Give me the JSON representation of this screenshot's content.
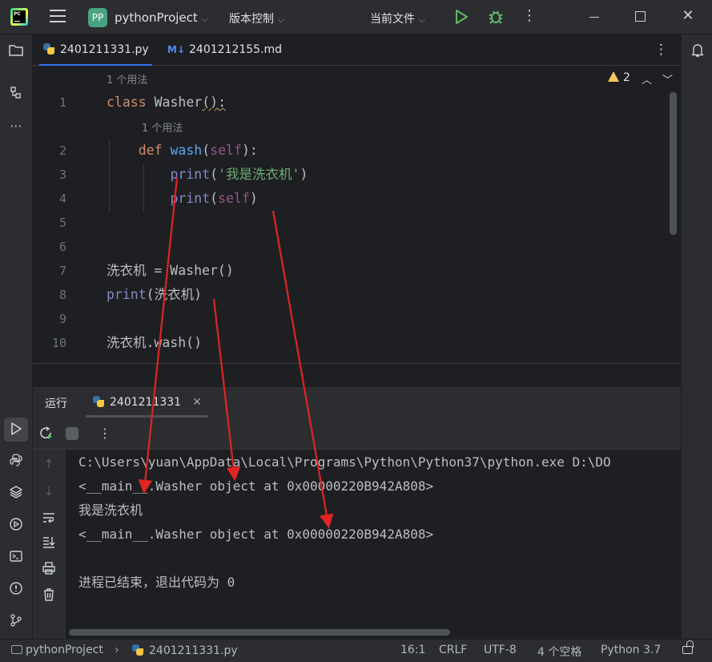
{
  "titlebar": {
    "logo_text": "PC",
    "project_badge": "PP",
    "project_name": "pythonProject",
    "vcs_label": "版本控制",
    "run_config": "当前文件",
    "icons": [
      "hamburger-menu-icon",
      "run-icon",
      "debug-icon",
      "more-icon",
      "minimize-icon",
      "maximize-icon",
      "close-icon"
    ]
  },
  "tabs": [
    {
      "label": "2401211331.py",
      "icon": "python-file-icon",
      "active": true
    },
    {
      "label": "2401212155.md",
      "icon": "markdown-file-icon",
      "active": false
    }
  ],
  "editor": {
    "usage_hint_class": "1 个用法",
    "usage_hint_method": "1 个用法",
    "warning_count": "2",
    "lines": [
      {
        "num": "1"
      },
      {
        "num": "2"
      },
      {
        "num": "3"
      },
      {
        "num": "4"
      },
      {
        "num": "5"
      },
      {
        "num": "6"
      },
      {
        "num": "7"
      },
      {
        "num": "8"
      },
      {
        "num": "9"
      },
      {
        "num": "10"
      }
    ],
    "code": {
      "l1_kw": "class",
      "l1_name": "Washer",
      "l1_rest": "():",
      "l2_kw": "def",
      "l2_fn": "wash",
      "l2_self": "self",
      "l3_fn": "print",
      "l3_str": "'我是洗衣机'",
      "l4_fn": "print",
      "l4_self": "self",
      "l7_text": "洗衣机 = Washer()",
      "l8_fn": "print",
      "l8_arg": "(洗衣机)",
      "l10_text": "洗衣机.wash()"
    }
  },
  "run_panel": {
    "title": "运行",
    "tab_label": "2401211331",
    "output": [
      "C:\\Users\\yuan\\AppData\\Local\\Programs\\Python\\Python37\\python.exe D:\\DO",
      "<__main__.Washer object at 0x00000220B942A808>",
      "我是洗衣机",
      "<__main__.Washer object at 0x00000220B942A808>",
      "",
      "进程已结束，退出代码为 0"
    ]
  },
  "statusbar": {
    "project": "pythonProject",
    "file": "2401211331.py",
    "position": "16:1",
    "line_ending": "CRLF",
    "encoding": "UTF-8",
    "indent": "4 个空格",
    "interpreter": "Python 3.7"
  },
  "colors": {
    "annotation_arrow": "#e02424",
    "accent": "#3574f0"
  }
}
